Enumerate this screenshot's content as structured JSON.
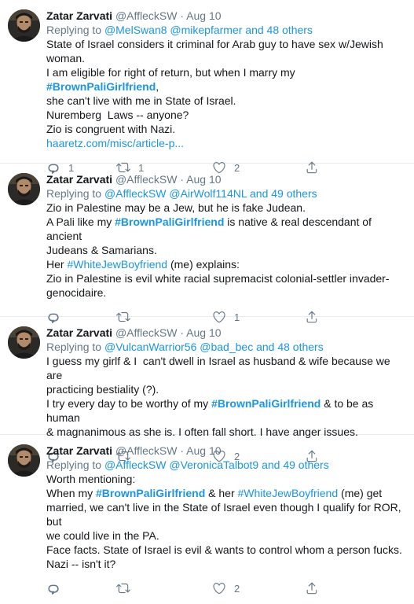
{
  "tweets": [
    {
      "name": "Zatar Zarvati",
      "handle": "@AffleckSW",
      "dot": "·",
      "date": "Aug 10",
      "replying_prefix": "Replying to ",
      "replying_links": "@MelSwan8 @mikepfarmer",
      "replying_suffix": " and 48 others",
      "lines": [
        "State of Israel considers it criminal for Arab guy to have sex w/Jewish",
        "woman."
      ],
      "line3_a": "I am eligible for right of return, but when I marry my ",
      "line3_tag": "#BrownPaliGirlfriend",
      "line3_b": ",",
      "line4": "she can't live with me in State of Israel.",
      "line5": "Nuremberg  Laws -- anyone?",
      "line6": "Zio is congruent with Nazi.",
      "link": "haaretz.com/misc/article-p...",
      "reply_count": "1",
      "retweet_count": "1",
      "like_count": "2"
    },
    {
      "name": "Zatar Zarvati",
      "handle": "@AffleckSW",
      "dot": "·",
      "date": "Aug 10",
      "replying_prefix": "Replying to ",
      "replying_links": "@AffleckSW @AirWolf114NL",
      "replying_suffix": " and 49 others",
      "line1": "Zio in Palestine may be a Jew, but he is fake Judean.",
      "line2_a": "A Pali like my ",
      "line2_tag": "#BrownPaliGirlfriend",
      "line2_b": " is native & real descendant of ancient",
      "line3": "Judeans & Samarians.",
      "line4_a": "Her ",
      "line4_tag": "#WhiteJewBoyfriend",
      "line4_b": " (me) explains:",
      "line5": "Zio in Palestine is evil white racial supremacist colonial-settler invader-",
      "line6": "genocidaire.",
      "reply_count": "",
      "retweet_count": "",
      "like_count": "1"
    },
    {
      "name": "Zatar Zarvati",
      "handle": "@AffleckSW",
      "dot": "·",
      "date": "Aug 10",
      "replying_prefix": "Replying to ",
      "replying_links": "@VulcanWarrior56 @bad_bec",
      "replying_suffix": " and 48 others",
      "line1": "I guess my girlf & I  can't dwell in Israel as husband & wife because we are",
      "line2": "practicing bestiality (?).",
      "line3_a": "I try every day to be worthy of my ",
      "line3_tag": "#BrownPaliGirlfriend",
      "line3_b": " & to be as human",
      "line4": "& magnanimous as she is. I often fall short. I have anger issues.",
      "reply_count": "",
      "retweet_count": "",
      "like_count": "2"
    },
    {
      "name": "Zatar Zarvati",
      "handle": "@AffleckSW",
      "dot": "·",
      "date": "Aug 10",
      "replying_prefix": "Replying to ",
      "replying_links": "@AffleckSW @VeronicaTalbot9",
      "replying_suffix": " and 49 others",
      "line1": "Worth mentioning:",
      "line2_a": "When my ",
      "line2_tag": "#BrownPaliGirlfriend",
      "line2_b": " & her ",
      "line2_tag2": "#WhiteJewBoyfriend",
      "line2_c": " (me) get",
      "line3": "married, we can't live in the State of Israel even though I qualify for ROR, but",
      "line4": "we could live in the PA.",
      "line5": "Face facts. State of Israel is evil & wants to control whom a person fucks.",
      "line6": "Nazi -- isn't it?",
      "reply_count": "",
      "retweet_count": "",
      "like_count": "2"
    }
  ],
  "icons": {
    "reply": "reply-icon",
    "retweet": "retweet-icon",
    "like": "heart-icon",
    "share": "share-icon"
  },
  "colors": {
    "link": "#1b95e0",
    "muted": "#657786",
    "divider": "#e6ecf0"
  }
}
